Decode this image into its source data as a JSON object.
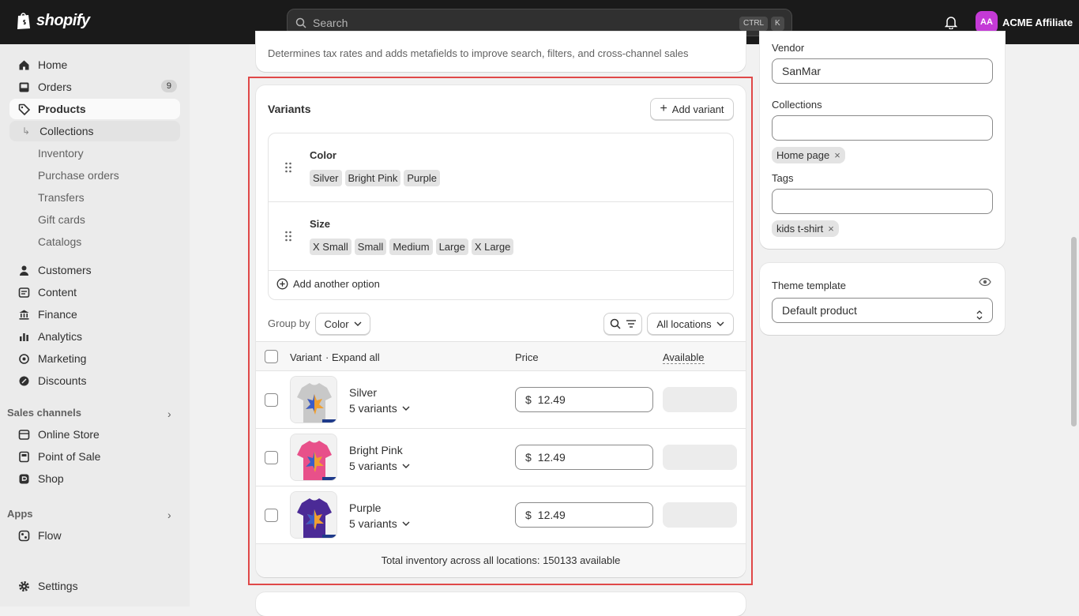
{
  "topbar": {
    "brand": "shopify",
    "search_placeholder": "Search",
    "shortcut_ctrl": "CTRL",
    "shortcut_k": "K",
    "account_initials": "AA",
    "account_name": "ACME Affiliate"
  },
  "sidebar": {
    "items": [
      {
        "label": "Home"
      },
      {
        "label": "Orders",
        "badge": "9"
      },
      {
        "label": "Products"
      },
      {
        "label": "Collections"
      },
      {
        "label": "Inventory"
      },
      {
        "label": "Purchase orders"
      },
      {
        "label": "Transfers"
      },
      {
        "label": "Gift cards"
      },
      {
        "label": "Catalogs"
      },
      {
        "label": "Customers"
      },
      {
        "label": "Content"
      },
      {
        "label": "Finance"
      },
      {
        "label": "Analytics"
      },
      {
        "label": "Marketing"
      },
      {
        "label": "Discounts"
      }
    ],
    "sales_channels_title": "Sales channels",
    "sales_channels": [
      {
        "label": "Online Store"
      },
      {
        "label": "Point of Sale"
      },
      {
        "label": "Shop"
      }
    ],
    "apps_title": "Apps",
    "apps": [
      {
        "label": "Flow"
      }
    ],
    "settings_label": "Settings"
  },
  "category_card": {
    "help_text": "Determines tax rates and adds metafields to improve search, filters, and cross-channel sales"
  },
  "variants": {
    "title": "Variants",
    "add_variant_label": "Add variant",
    "options": [
      {
        "name": "Color",
        "values": [
          "Silver",
          "Bright Pink",
          "Purple"
        ]
      },
      {
        "name": "Size",
        "values": [
          "X Small",
          "Small",
          "Medium",
          "Large",
          "X Large"
        ]
      }
    ],
    "add_option_label": "Add another option",
    "group_by_label": "Group by",
    "group_by_value": "Color",
    "locations_value": "All locations",
    "columns": {
      "variant": "Variant",
      "expand_all": "· Expand all",
      "price": "Price",
      "available": "Available"
    },
    "rows": [
      {
        "name": "Silver",
        "count": "5 variants",
        "currency": "$",
        "price": "12.49",
        "shirt_color": "#c8c8c8"
      },
      {
        "name": "Bright Pink",
        "count": "5 variants",
        "currency": "$",
        "price": "12.49",
        "shirt_color": "#e8508a"
      },
      {
        "name": "Purple",
        "count": "5 variants",
        "currency": "$",
        "price": "12.49",
        "shirt_color": "#4b2a96"
      }
    ],
    "total_text": "Total inventory across all locations: 150133 available"
  },
  "organization": {
    "vendor_label": "Vendor",
    "vendor_value": "SanMar",
    "collections_label": "Collections",
    "collections_value": "",
    "collection_tags": [
      "Home page"
    ],
    "tags_label": "Tags",
    "tags_value": "",
    "tag_chips": [
      "kids t-shirt"
    ]
  },
  "theme": {
    "label": "Theme template",
    "value": "Default product"
  },
  "colors": {
    "topbar": "#1a1a1a",
    "avatar": "#c43ad6",
    "highlight": "#e04848"
  }
}
